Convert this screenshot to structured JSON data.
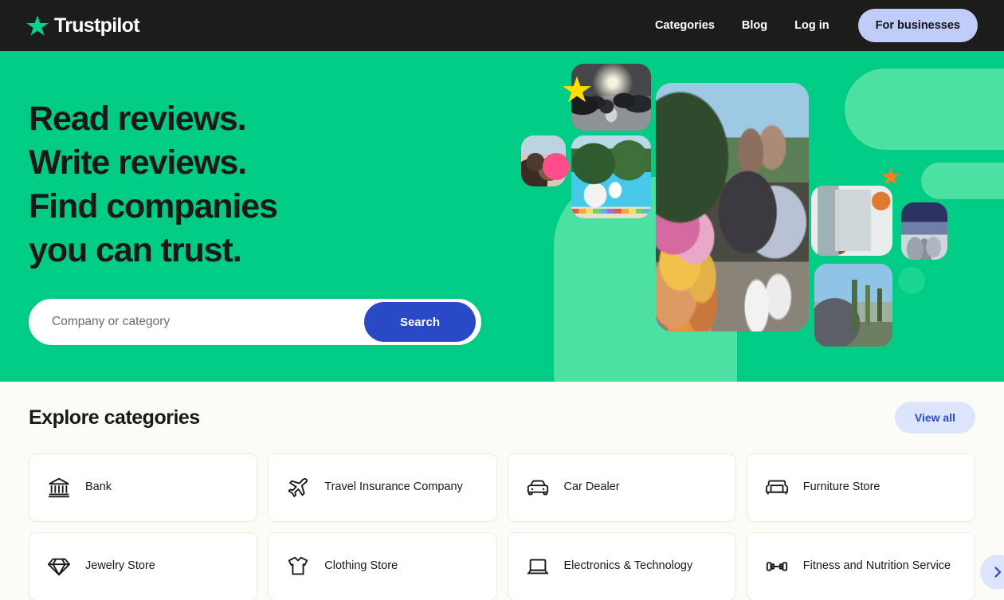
{
  "header": {
    "brand": "Trustpilot",
    "logo_star_color": "#00D094",
    "background": "#1C1C1B",
    "nav": [
      {
        "label": "Categories",
        "name": "nav-categories"
      },
      {
        "label": "Blog",
        "name": "nav-blog"
      },
      {
        "label": "Log in",
        "name": "nav-login"
      }
    ],
    "business_button": {
      "label": "For businesses",
      "background": "#BFCCF7",
      "text_color": "#131212"
    }
  },
  "hero": {
    "background": "#00CC85",
    "title_lines": [
      "Read reviews.",
      "Write reviews.",
      "Find companies",
      "you can trust."
    ],
    "search": {
      "placeholder": "Company or category",
      "value": "",
      "button_label": "Search",
      "button_color": "#2A49C6"
    },
    "collage": {
      "accent_shape_color": "#4DE0A3",
      "decorations": [
        {
          "name": "pink-dot",
          "color": "#FF4C8B"
        },
        {
          "name": "green-dot",
          "color": "#19D68F"
        },
        {
          "name": "yellow-star",
          "color": "#FFDD00"
        },
        {
          "name": "orange-star",
          "color": "#F2841E"
        }
      ],
      "tiles": [
        {
          "name": "photo-concert-crowd"
        },
        {
          "name": "photo-couple-rooftop"
        },
        {
          "name": "photo-swimming-pool"
        },
        {
          "name": "photo-flower-market-women"
        },
        {
          "name": "photo-shelf-interior"
        },
        {
          "name": "photo-snow-cityscape"
        },
        {
          "name": "photo-man-cactus"
        }
      ]
    }
  },
  "categories": {
    "background": "#FCFBF6",
    "title": "Explore categories",
    "view_all_label": "View all",
    "view_all_color": "#2A49C6",
    "next_arrow": "›",
    "items": [
      {
        "label": "Bank",
        "icon": "bank-icon"
      },
      {
        "label": "Travel Insurance Company",
        "icon": "airplane-icon"
      },
      {
        "label": "Car Dealer",
        "icon": "car-icon"
      },
      {
        "label": "Furniture Store",
        "icon": "armchair-icon"
      },
      {
        "label": "Jewelry Store",
        "icon": "diamond-icon"
      },
      {
        "label": "Clothing Store",
        "icon": "tshirt-icon"
      },
      {
        "label": "Electronics & Technology",
        "icon": "laptop-icon"
      },
      {
        "label": "Fitness and Nutrition Service",
        "icon": "dumbbell-icon"
      }
    ]
  }
}
